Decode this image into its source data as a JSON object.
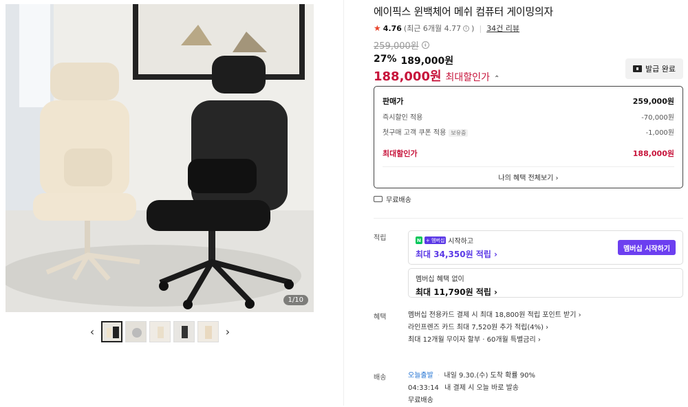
{
  "gallery": {
    "counter": "1/10",
    "prev_icon": "‹",
    "next_icon": "›"
  },
  "product": {
    "title": "에이픽스 윈백체어 메쉬 컴퓨터 게이밍의자",
    "rating": "4.76",
    "rating_recent": "(최근 6개월 4.77",
    "rating_recent_close": ")",
    "review_count": "34건 리뷰",
    "original_price": "259,000원",
    "discount_rate": "27%",
    "discount_price": "189,000원",
    "final_price": "188,000원",
    "final_label": "최대할인가",
    "coupon_button": "발급 완료"
  },
  "price_box": {
    "sale_label": "판매가",
    "sale_value": "259,000원",
    "instant_label": "즉시할인 적용",
    "instant_value": "-70,000원",
    "first_label": "첫구매 고객 쿠폰 적용",
    "first_tag": "보유중",
    "first_value": "-1,000원",
    "max_label": "최대할인가",
    "max_value": "188,000원",
    "benefits_link": "나의 혜택 전체보기 ›"
  },
  "shipping": {
    "label": "무료배송"
  },
  "points": {
    "label": "적립",
    "card1_n": "N",
    "card1_plus": "+ 멤버십",
    "card1_text": "시작하고",
    "card1_amount": "최대 34,350원 적립 ›",
    "card1_button": "멤버십 시작하기",
    "card2_text": "멤버십 혜택 없이",
    "card2_amount": "최대 11,790원 적립 ›"
  },
  "benefits": {
    "label": "혜택",
    "items": [
      "멤버십 전용카드 결제 시 최대 18,800원 적립 포인트 받기 ›",
      "라인프렌즈 카드 최대 7,520원 추가 적립(4%) ›",
      "최대 12개월 무이자 할부 · 60개월 특별금리 ›"
    ]
  },
  "delivery": {
    "label": "배송",
    "today": "오늘출발",
    "arrival": "내일 9.30.(수) 도착 확률 90%",
    "countdown": "04:33:14",
    "countdown_text": "내 결제 시 오늘 바로 발송",
    "free": "무료배송"
  },
  "colors": {
    "accent_red": "#c7143b",
    "star": "#e8452c",
    "purple": "#6c3ff0",
    "blue": "#1c6fd1"
  }
}
